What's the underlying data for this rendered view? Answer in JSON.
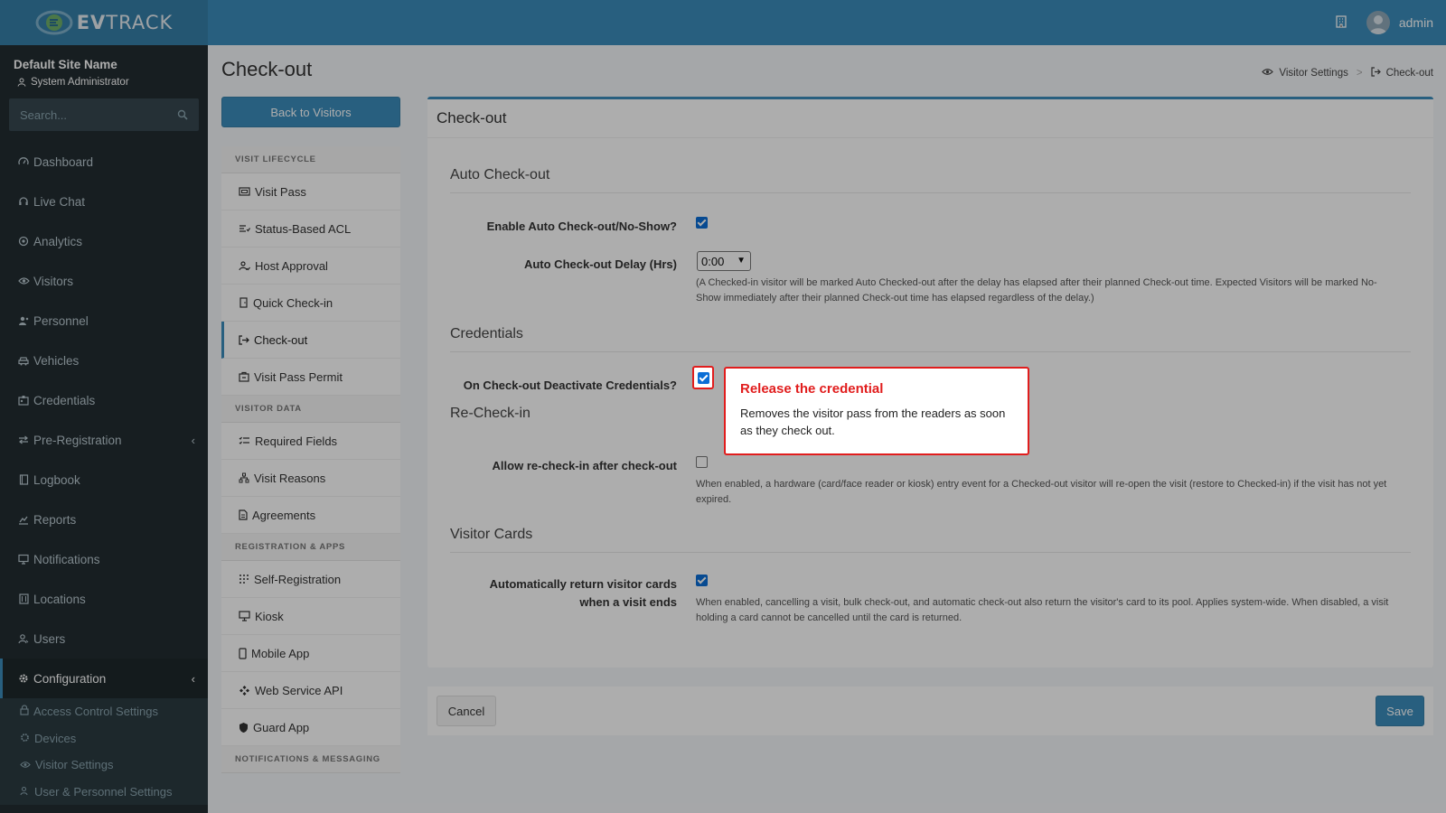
{
  "header": {
    "brand_ev": "EV",
    "brand_track": "TRACK",
    "user": "admin"
  },
  "sidebar": {
    "site_name": "Default Site Name",
    "role": "System Administrator",
    "search_placeholder": "Search...",
    "items": [
      {
        "label": "Dashboard",
        "icon": "dashboard-icon"
      },
      {
        "label": "Live Chat",
        "icon": "headset-icon"
      },
      {
        "label": "Analytics",
        "icon": "analytics-icon"
      },
      {
        "label": "Visitors",
        "icon": "eye-icon"
      },
      {
        "label": "Personnel",
        "icon": "personnel-icon"
      },
      {
        "label": "Vehicles",
        "icon": "car-icon"
      },
      {
        "label": "Credentials",
        "icon": "id-card-icon"
      },
      {
        "label": "Pre-Registration",
        "icon": "exchange-icon"
      },
      {
        "label": "Logbook",
        "icon": "book-icon"
      },
      {
        "label": "Reports",
        "icon": "reports-icon"
      },
      {
        "label": "Notifications",
        "icon": "notification-icon"
      },
      {
        "label": "Locations",
        "icon": "building-icon"
      },
      {
        "label": "Users",
        "icon": "users-icon"
      },
      {
        "label": "Configuration",
        "icon": "gear-icon"
      }
    ],
    "sub_items": [
      {
        "label": "Access Control Settings",
        "icon": "lock-icon"
      },
      {
        "label": "Devices",
        "icon": "cog-icon"
      },
      {
        "label": "Visitor Settings",
        "icon": "eye-icon"
      },
      {
        "label": "User & Personnel Settings",
        "icon": "users-icon"
      }
    ]
  },
  "page": {
    "title": "Check-out",
    "breadcrumb": {
      "parent": "Visitor Settings",
      "separator": ">",
      "current": "Check-out"
    },
    "back_button": "Back to Visitors"
  },
  "settings_nav": {
    "sections": [
      {
        "header": "VISIT LIFECYCLE",
        "items": [
          "Visit Pass",
          "Status-Based ACL",
          "Host Approval",
          "Quick Check-in",
          "Check-out",
          "Visit Pass Permit"
        ]
      },
      {
        "header": "VISITOR DATA",
        "items": [
          "Required Fields",
          "Visit Reasons",
          "Agreements"
        ]
      },
      {
        "header": "REGISTRATION & APPS",
        "items": [
          "Self-Registration",
          "Kiosk",
          "Mobile App",
          "Web Service API",
          "Guard App"
        ]
      },
      {
        "header": "NOTIFICATIONS & MESSAGING",
        "items": []
      }
    ],
    "active": "Check-out"
  },
  "card": {
    "title": "Check-out",
    "auto_checkout": {
      "title": "Auto Check-out",
      "enable_label": "Enable Auto Check-out/No-Show?",
      "enable_checked": true,
      "delay_label": "Auto Check-out Delay (Hrs)",
      "delay_value": "0:00",
      "delay_help": "(A Checked-in visitor will be marked Auto Checked-out after the delay has elapsed after their planned Check-out time. Expected Visitors will be marked No-Show immediately after their planned Check-out time has elapsed regardless of the delay.)"
    },
    "credentials": {
      "title": "Credentials",
      "deactivate_label": "On Check-out Deactivate Credentials?",
      "deactivate_checked": true
    },
    "recheckin": {
      "title": "Re-Check-in",
      "allow_label": "Allow re-check-in after check-out",
      "allow_checked": false,
      "allow_help": "When enabled, a hardware (card/face reader or kiosk) entry event for a Checked-out visitor will re-open the visit (restore to Checked-in) if the visit has not yet expired."
    },
    "visitor_cards": {
      "title": "Visitor Cards",
      "return_label_1": "Automatically return visitor cards",
      "return_label_2": "when a visit ends",
      "return_checked": true,
      "return_help": "When enabled, cancelling a visit, bulk check-out, and automatic check-out also return the visitor's card to its pool. Applies system-wide. When disabled, a visit holding a card cannot be cancelled until the card is returned."
    }
  },
  "footer": {
    "cancel": "Cancel",
    "save": "Save"
  },
  "tooltip": {
    "title": "Release the credential",
    "body": "Removes the visitor pass from the readers as soon as they check out."
  },
  "colors": {
    "accent": "#3c8dbc",
    "sidebar": "#222d32",
    "highlight": "#e11d1d"
  }
}
